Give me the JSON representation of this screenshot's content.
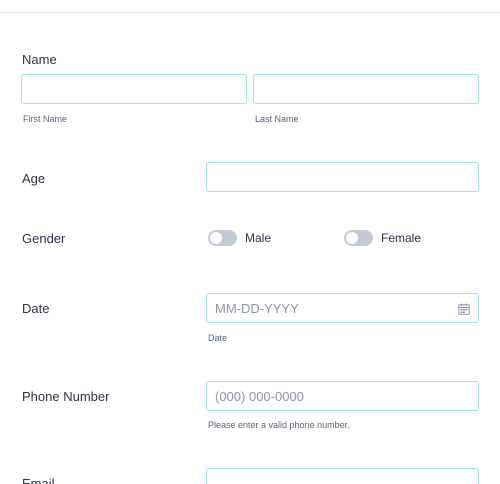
{
  "name": {
    "label": "Name",
    "first_sub": "First Name",
    "last_sub": "Last Name",
    "first_value": "",
    "last_value": ""
  },
  "age": {
    "label": "Age",
    "value": ""
  },
  "gender": {
    "label": "Gender",
    "options": [
      "Male",
      "Female"
    ],
    "selected": null
  },
  "date": {
    "label": "Date",
    "placeholder": "MM-DD-YYYY",
    "sub": "Date",
    "icon": "calendar-icon"
  },
  "phone": {
    "label": "Phone Number",
    "placeholder": "(000) 000-0000",
    "sub": "Please enter a valid phone number."
  },
  "email": {
    "label": "Email"
  },
  "colors": {
    "input_border": "#9ee6ea",
    "label_text": "#2c3345",
    "sublabel_text": "#57647e",
    "toggle_off": "#c3cad8"
  }
}
